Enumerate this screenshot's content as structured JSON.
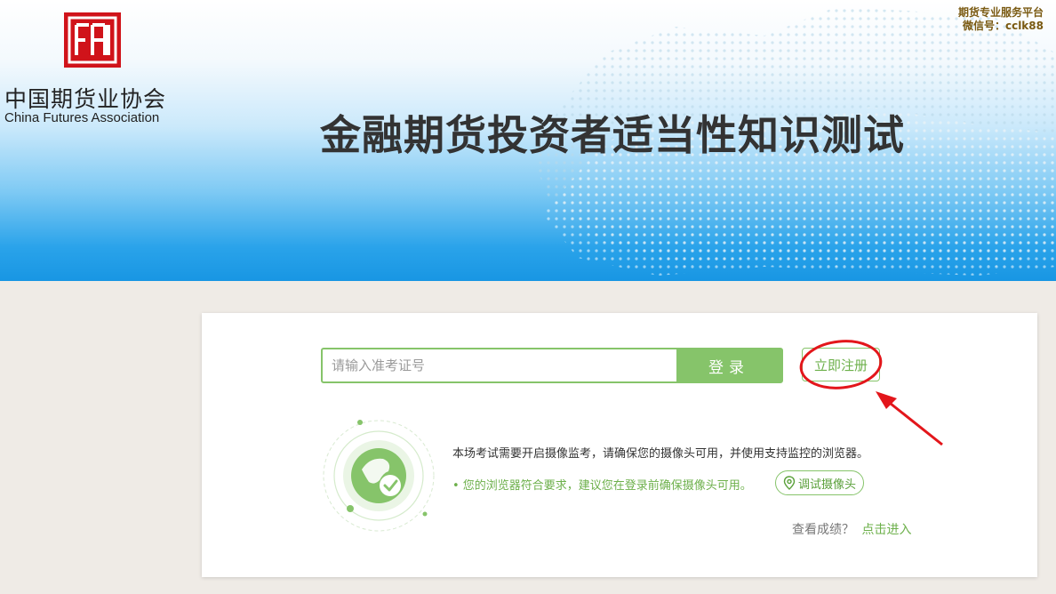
{
  "header": {
    "org_name_zh": "中国期货业协会",
    "org_name_en": "China Futures Association",
    "title": "金融期货投资者适当性知识测试",
    "corner_line1": "期货专业服务平台",
    "corner_line2": "微信号：cclk88"
  },
  "login": {
    "placeholder": "请输入准考证号",
    "value": "",
    "login_label": "登录",
    "register_label": "立即注册"
  },
  "notice": {
    "camera_requirement": "本场考试需要开启摄像监考，请确保您的摄像头可用，并使用支持监控的浏览器。",
    "browser_status": "• 您的浏览器符合要求，建议您在登录前确保摄像头可用。",
    "test_camera_label": "调试摄像头"
  },
  "score": {
    "prompt": "查看成绩？",
    "link": "点击进入"
  },
  "colors": {
    "accent_green": "#86c46a",
    "brand_red": "#d0131a",
    "annotation_red": "#e3161b"
  },
  "icons": {
    "logo": "cfa-logo-icon",
    "globe_check": "globe-check-icon",
    "location_pin": "location-pin-icon"
  }
}
